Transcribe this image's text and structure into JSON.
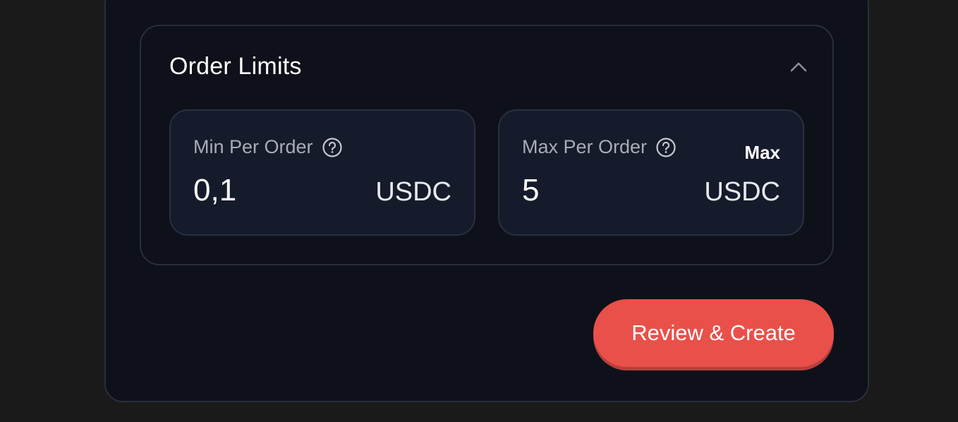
{
  "order_limits": {
    "title": "Order Limits",
    "collapse_icon": "chevron-up-icon",
    "min_field": {
      "label": "Min Per Order",
      "help_icon": "question-circle-icon",
      "value": "0,1",
      "unit": "USDC"
    },
    "max_field": {
      "label": "Max Per Order",
      "help_icon": "question-circle-icon",
      "max_label": "Max",
      "value": "5",
      "unit": "USDC"
    }
  },
  "actions": {
    "review_create_label": "Review & Create"
  },
  "colors": {
    "background": "#1a1a1a",
    "card": "#0f111a",
    "field": "#161b2b",
    "border": "#2a2e3b",
    "accent": "#e9504a"
  }
}
